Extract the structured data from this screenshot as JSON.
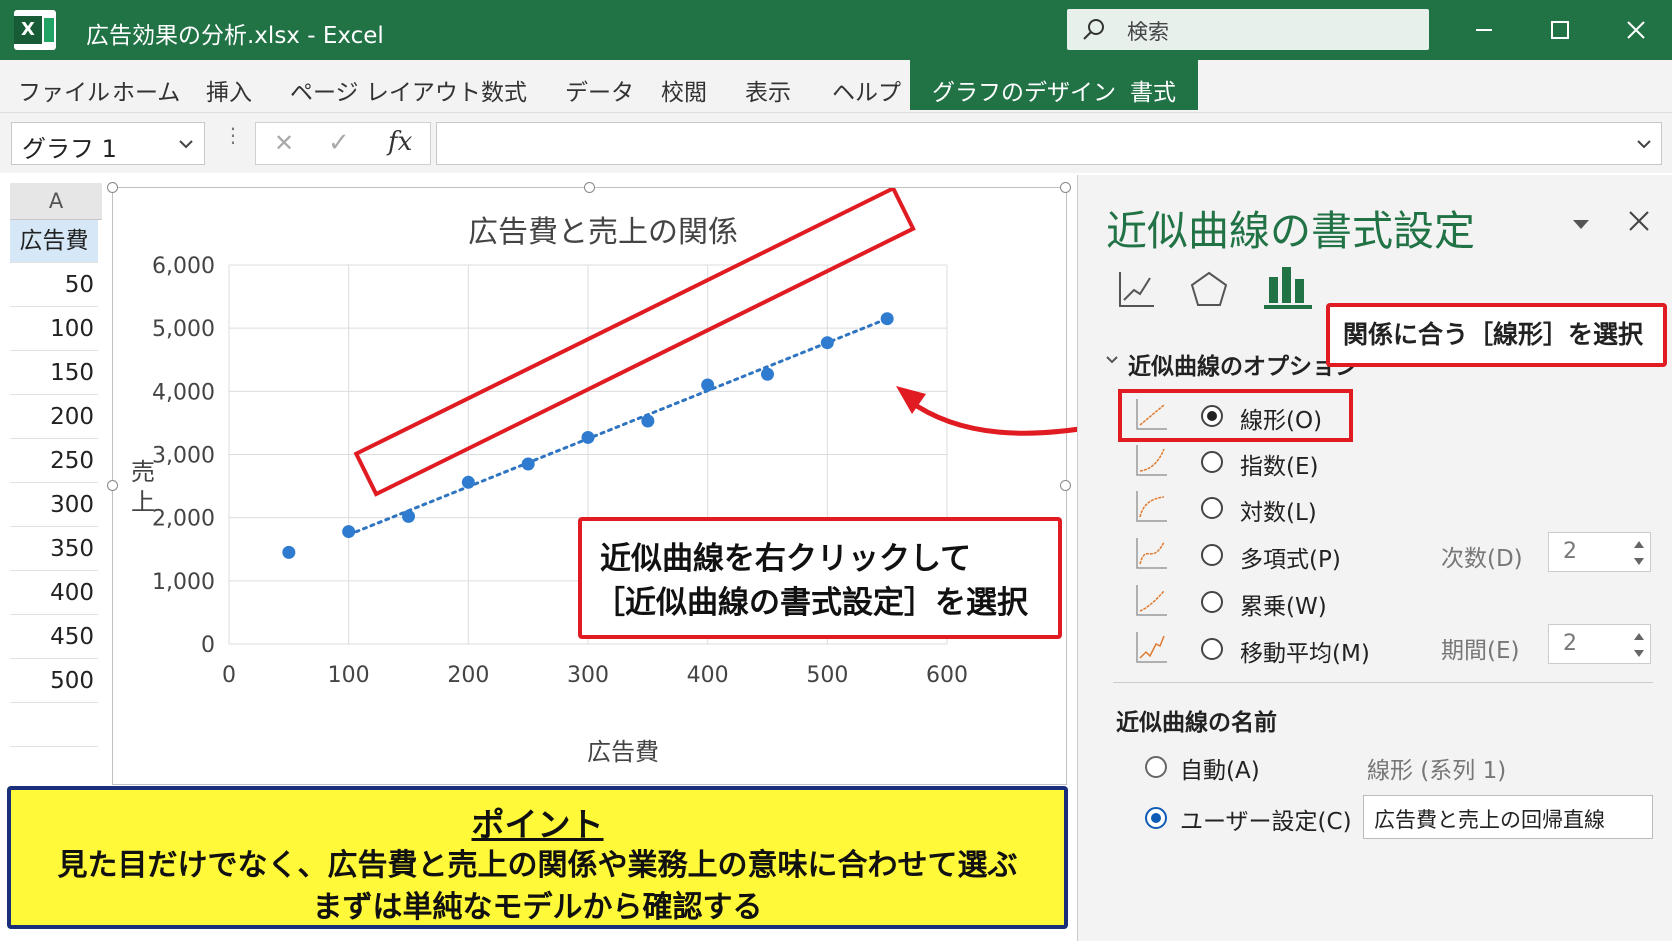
{
  "window": {
    "title": "広告効果の分析.xlsx  -  Excel",
    "search_placeholder": "検索",
    "controls": [
      "minimize",
      "maximize",
      "close"
    ]
  },
  "menu": {
    "items": [
      "ファイル",
      "ホーム",
      "挿入",
      "ページ レイアウト",
      "数式",
      "データ",
      "校閲",
      "表示",
      "ヘルプ"
    ],
    "context_tabs": [
      "グラフのデザイン",
      "書式"
    ]
  },
  "formula_bar": {
    "name_box": "グラフ 1",
    "cancel": "✕",
    "enter": "✓",
    "fx": "fx",
    "value": ""
  },
  "sheet": {
    "column": "A",
    "header": "広告費",
    "values": [
      "50",
      "100",
      "150",
      "200",
      "250",
      "300",
      "350",
      "400",
      "450",
      "500"
    ]
  },
  "chart_data": {
    "type": "scatter",
    "title": "広告費と売上の関係",
    "xlabel": "広告費",
    "ylabel": "売上",
    "xlim": [
      0,
      600
    ],
    "ylim": [
      0,
      6000
    ],
    "xticks": [
      "0",
      "100",
      "200",
      "300",
      "400",
      "500",
      "600"
    ],
    "yticks": [
      "0",
      "1,000",
      "2,000",
      "3,000",
      "4,000",
      "5,000",
      "6,000"
    ],
    "grid": true,
    "series": [
      {
        "x": [
          50,
          100,
          150,
          200,
          250,
          300,
          350,
          400,
          450,
          500,
          550
        ],
        "y": [
          1450,
          1780,
          2020,
          2560,
          2850,
          3270,
          3530,
          4100,
          4270,
          4770,
          5150
        ]
      }
    ],
    "trendline": {
      "type": "linear",
      "x": [
        100,
        550
      ],
      "y": [
        1730,
        5150
      ]
    },
    "colors": {
      "points": "#2e7bcf",
      "trendline": "#2e74c0"
    }
  },
  "callouts": {
    "chart": [
      "近似曲線を右クリックして",
      "［近似曲線の書式設定］を選択"
    ],
    "pane": "関係に合う［線形］を選択"
  },
  "point_box": {
    "title": "ポイント",
    "line1": "見た目だけでなく、広告費と売上の関係や業務上の意味に合わせて選ぶ",
    "line2": "まずは単純なモデルから確認する"
  },
  "format_pane": {
    "title": "近似曲線の書式設定",
    "section": "近似曲線のオプション",
    "options": [
      {
        "label": "線形(O)",
        "selected": true
      },
      {
        "label": "指数(E)",
        "selected": false
      },
      {
        "label": "対数(L)",
        "selected": false
      },
      {
        "label": "多項式(P)",
        "selected": false
      },
      {
        "label": "累乗(W)",
        "selected": false
      },
      {
        "label": "移動平均(M)",
        "selected": false
      }
    ],
    "order": {
      "label": "次数(D)",
      "value": "2"
    },
    "period": {
      "label": "期間(E)",
      "value": "2"
    },
    "name_section": "近似曲線の名前",
    "name_auto": {
      "label": "自動(A)",
      "value": "線形 (系列 1)",
      "selected": false
    },
    "name_custom": {
      "label": "ユーザー設定(C)",
      "value": "広告費と売上の回帰直線",
      "selected": true
    }
  },
  "colors": {
    "excel_green": "#217346",
    "callout_red": "#e01b22",
    "point_yellow": "#fff93a",
    "point_border": "#1b2e7a",
    "trend_orange": "#e07a2e"
  }
}
